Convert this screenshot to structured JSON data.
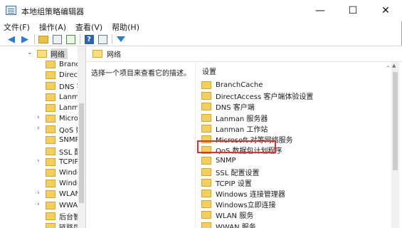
{
  "window": {
    "title": "本地组策略编辑器",
    "controls": {
      "minimize": "—",
      "maximize": "☐",
      "close": "✕"
    }
  },
  "menu": [
    "文件(F)",
    "操作(A)",
    "查看(V)",
    "帮助(H)"
  ],
  "toolbar": {
    "icons": [
      "back-arrow-icon",
      "forward-arrow-icon",
      "folder-up-icon",
      "show-hide-tree-icon",
      "export-list-icon",
      "help-icon",
      "properties-icon",
      "filter-icon"
    ]
  },
  "tree": {
    "root": {
      "label": "网络",
      "expander": "⌄"
    },
    "items": [
      {
        "label": "Branch",
        "expander": ""
      },
      {
        "label": "Direct",
        "expander": ""
      },
      {
        "label": "DNS 客",
        "expander": ""
      },
      {
        "label": "Lanma",
        "expander": ""
      },
      {
        "label": "Lanma",
        "expander": ""
      },
      {
        "label": "Micro",
        "expander": "›"
      },
      {
        "label": "QoS 数",
        "expander": "›"
      },
      {
        "label": "SNMP",
        "expander": ""
      },
      {
        "label": "SSL 配",
        "expander": ""
      },
      {
        "label": "TCPIP",
        "expander": "›"
      },
      {
        "label": "Windo",
        "expander": ""
      },
      {
        "label": "Windo",
        "expander": ""
      },
      {
        "label": "WLAN",
        "expander": "›"
      },
      {
        "label": "WWAI",
        "expander": "›"
      },
      {
        "label": "后台智",
        "expander": ""
      },
      {
        "label": "链路层",
        "expander": ""
      }
    ]
  },
  "pane": {
    "header": "网络",
    "description": "选择一个项目来查看它的描述。",
    "column_header": "设置",
    "items": [
      "BranchCache",
      "DirectAccess 客户端体验设置",
      "DNS 客户端",
      "Lanman 服务器",
      "Lanman 工作站",
      "Microsoft 对等网络服务",
      "QoS 数据包计划程序",
      "SNMP",
      "SSL 配置设置",
      "TCPIP 设置",
      "Windows 连接管理器",
      "Windows立即连接",
      "WLAN 服务",
      "WWAN 服务"
    ],
    "highlighted_item": "QoS 数据包计划程序",
    "highlight_color": "#e03131"
  }
}
